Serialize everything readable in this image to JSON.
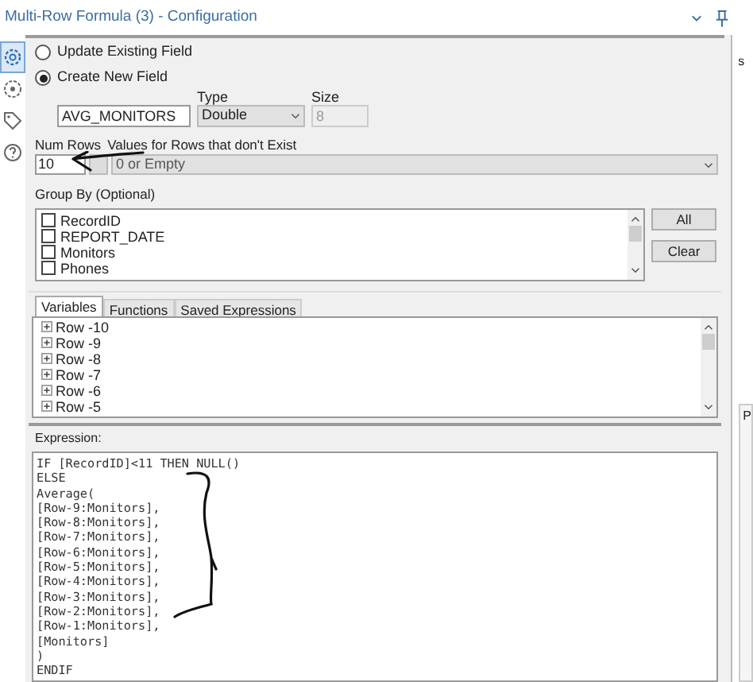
{
  "window": {
    "title": "Multi-Row Formula (3) - Configuration"
  },
  "side_rail": [
    {
      "kind": "gear",
      "selected": true
    },
    {
      "kind": "circle",
      "selected": false
    },
    {
      "kind": "tag",
      "selected": false
    },
    {
      "kind": "help",
      "selected": false
    }
  ],
  "mode": [
    {
      "label": "Update Existing Field",
      "selected": false
    },
    {
      "label": "Create New  Field",
      "selected": true
    }
  ],
  "new_field": {
    "value": "AVG_MONITORS",
    "type_label": "Type",
    "type_value": "Double",
    "size_label": "Size",
    "size_value": "8"
  },
  "num_rows": {
    "label": "Num Rows",
    "value": "10"
  },
  "missing_rows": {
    "label": "Values for Rows that don't Exist",
    "value": "0 or Empty"
  },
  "group_by": {
    "label": "Group By (Optional)",
    "items": [
      {
        "label": "RecordID",
        "checked": false
      },
      {
        "label": "REPORT_DATE",
        "checked": false
      },
      {
        "label": "Monitors",
        "checked": false
      },
      {
        "label": "Phones",
        "checked": false
      }
    ],
    "buttons": [
      "All",
      "Clear"
    ]
  },
  "tabs": [
    {
      "label": "Variables",
      "selected": true
    },
    {
      "label": "Functions",
      "selected": false
    },
    {
      "label": "Saved Expressions",
      "selected": false
    }
  ],
  "variables": [
    "Row -10",
    "Row -9",
    "Row -8",
    "Row -7",
    "Row -6",
    "Row -5"
  ],
  "expression": {
    "label": "Expression:",
    "lines": [
      "IF [RecordID]<11 THEN NULL()",
      "ELSE",
      "Average(",
      "[Row-9:Monitors],",
      "[Row-8:Monitors],",
      "[Row-7:Monitors],",
      "[Row-6:Monitors],",
      "[Row-5:Monitors],",
      "[Row-4:Monitors],",
      "[Row-3:Monitors],",
      "[Row-2:Monitors],",
      "[Row-1:Monitors],",
      "[Monitors]",
      ")",
      "ENDIF"
    ]
  },
  "side_panel": [
    "s",
    "P"
  ]
}
